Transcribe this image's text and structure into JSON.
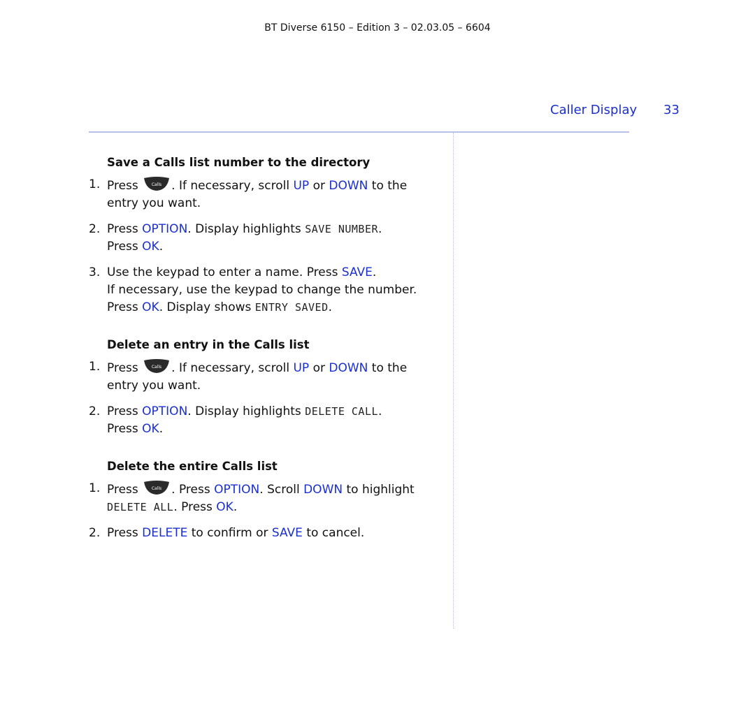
{
  "header": {
    "doc_info": "BT Diverse 6150 – Edition 3 – 02.03.05 – 6604",
    "section_title": "Caller Display",
    "page_number": "33"
  },
  "colors": {
    "accent": "#1a2fd0",
    "rule": "#b6c0e8"
  },
  "icons": {
    "calls_button": "calls-button-icon",
    "calls_button_label": "Calls"
  },
  "sections": [
    {
      "heading": "Save a Calls list number to the directory",
      "steps": [
        {
          "num": "1.",
          "parts": {
            "t1": "Press",
            "t2": ". If necessary, scroll",
            "k1": "UP",
            "t3": "or",
            "k2": "DOWN",
            "t4": "to the entry you want."
          }
        },
        {
          "num": "2.",
          "parts": {
            "t1": "Press",
            "k1": "OPTION",
            "t2": ". Display highlights",
            "lcd1": "SAVE NUMBER",
            "t3": ".",
            "t4": "Press",
            "k2": "OK",
            "t5": "."
          }
        },
        {
          "num": "3.",
          "parts": {
            "t1": "Use the keypad to enter a name. Press",
            "k1": "SAVE",
            "t2": ".",
            "t3": "If necessary, use the keypad to change the number.",
            "t4": "Press",
            "k2": "OK",
            "t5": ". Display shows",
            "lcd1": "ENTRY SAVED",
            "t6": "."
          }
        }
      ]
    },
    {
      "heading": "Delete an entry in the Calls list",
      "steps": [
        {
          "num": "1.",
          "parts": {
            "t1": "Press",
            "t2": ". If necessary, scroll",
            "k1": "UP",
            "t3": "or",
            "k2": "DOWN",
            "t4": "to the entry you want."
          }
        },
        {
          "num": "2.",
          "parts": {
            "t1": "Press",
            "k1": "OPTION",
            "t2": ". Display highlights",
            "lcd1": "DELETE CALL",
            "t3": ".",
            "t4": "Press",
            "k2": "OK",
            "t5": "."
          }
        }
      ]
    },
    {
      "heading": "Delete the entire Calls list",
      "steps": [
        {
          "num": "1.",
          "parts": {
            "t1": "Press",
            "t2": ". Press",
            "k1": "OPTION",
            "t3": ". Scroll",
            "k2": "DOWN",
            "t4": "to highlight",
            "lcd1": "DELETE ALL",
            "t5": ". Press",
            "k3": "OK",
            "t6": "."
          }
        },
        {
          "num": "2.",
          "parts": {
            "t1": "Press",
            "k1": "DELETE",
            "t2": "to confirm or",
            "k2": "SAVE",
            "t3": "to cancel."
          }
        }
      ]
    }
  ]
}
